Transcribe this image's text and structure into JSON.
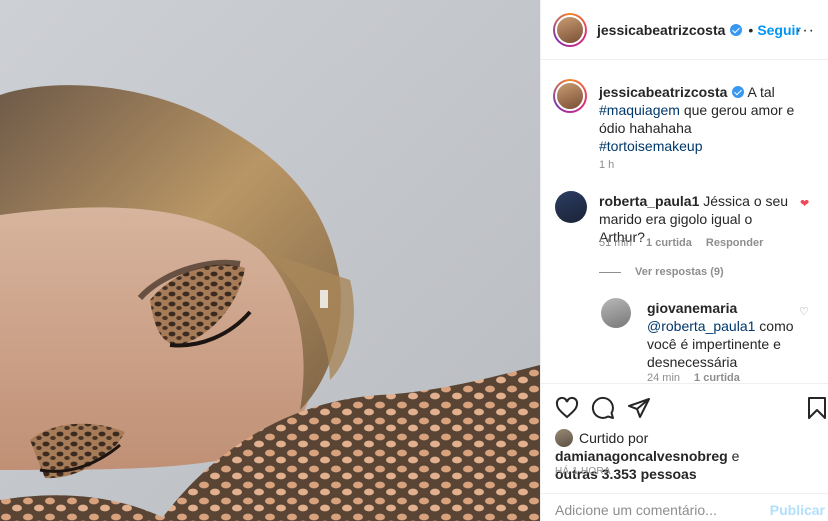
{
  "post": {
    "image_alt": "Foto de mulher deitada com maquiagem de tartaruga nos olhos",
    "header": {
      "username": "jessicabeatrizcosta",
      "follow_label": "Seguir",
      "more_label": "···"
    },
    "caption": {
      "username": "jessicabeatrizcosta",
      "text_1": "A tal",
      "hashtag_1": "#maquiagem",
      "text_2": "que gerou amor e ódio hahahaha",
      "hashtag_2": "#tortoisemakeup",
      "time": "1 h"
    },
    "comments": [
      {
        "username": "roberta_paula1",
        "text": "Jéssica o seu marido era gigolo igual o Arthur?",
        "time": "51 min",
        "likes": "1 curtida",
        "reply_label": "Responder",
        "liked": true
      }
    ],
    "view_replies": "Ver respostas (9)",
    "reply": {
      "username": "giovanemaria",
      "mention": "@roberta_paula1",
      "text": "como você é impertinente e desnecessária",
      "time": "24 min",
      "likes": "1 curtida"
    },
    "liked_by": {
      "prefix": "Curtido por",
      "user": "damianagoncalvesnobreg",
      "conj": "e",
      "others": "outras 3.353 pessoas"
    },
    "timestamp": "HÁ 1 HORA",
    "add_comment": {
      "placeholder": "Adicione um comentário...",
      "publish_label": "Publicar"
    },
    "colors": {
      "link_blue": "#0095f6",
      "heart_red": "#ed4956",
      "muted": "#8e8e8e"
    },
    "icons": [
      "heart-icon",
      "comment-icon",
      "share-icon",
      "bookmark-icon",
      "verified-badge-icon"
    ]
  }
}
